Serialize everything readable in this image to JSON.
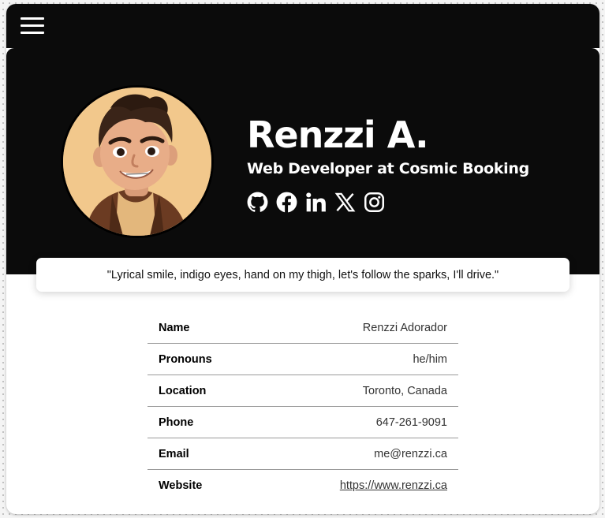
{
  "profile": {
    "name": "Renzzi A.",
    "title": "Web Developer at Cosmic Booking",
    "avatar_alt": "Memoji avatar of Renzzi"
  },
  "social_links": [
    {
      "icon": "github-icon",
      "label": "GitHub"
    },
    {
      "icon": "facebook-icon",
      "label": "Facebook"
    },
    {
      "icon": "linkedin-icon",
      "label": "LinkedIn"
    },
    {
      "icon": "x-icon",
      "label": "X"
    },
    {
      "icon": "instagram-icon",
      "label": "Instagram"
    }
  ],
  "quote": "\"Lyrical smile, indigo eyes, hand on my thigh, let's follow the sparks, I'll drive.\"",
  "details": [
    {
      "label": "Name",
      "value": "Renzzi Adorador"
    },
    {
      "label": "Pronouns",
      "value": "he/him"
    },
    {
      "label": "Location",
      "value": "Toronto, Canada"
    },
    {
      "label": "Phone",
      "value": "647-261-9091"
    },
    {
      "label": "Email",
      "value": "me@renzzi.ca"
    },
    {
      "label": "Website",
      "value": "https://www.renzzi.ca"
    }
  ],
  "colors": {
    "header_background": "#0b0b0b",
    "avatar_background": "#f2c88c",
    "text_on_dark": "#ffffff"
  }
}
